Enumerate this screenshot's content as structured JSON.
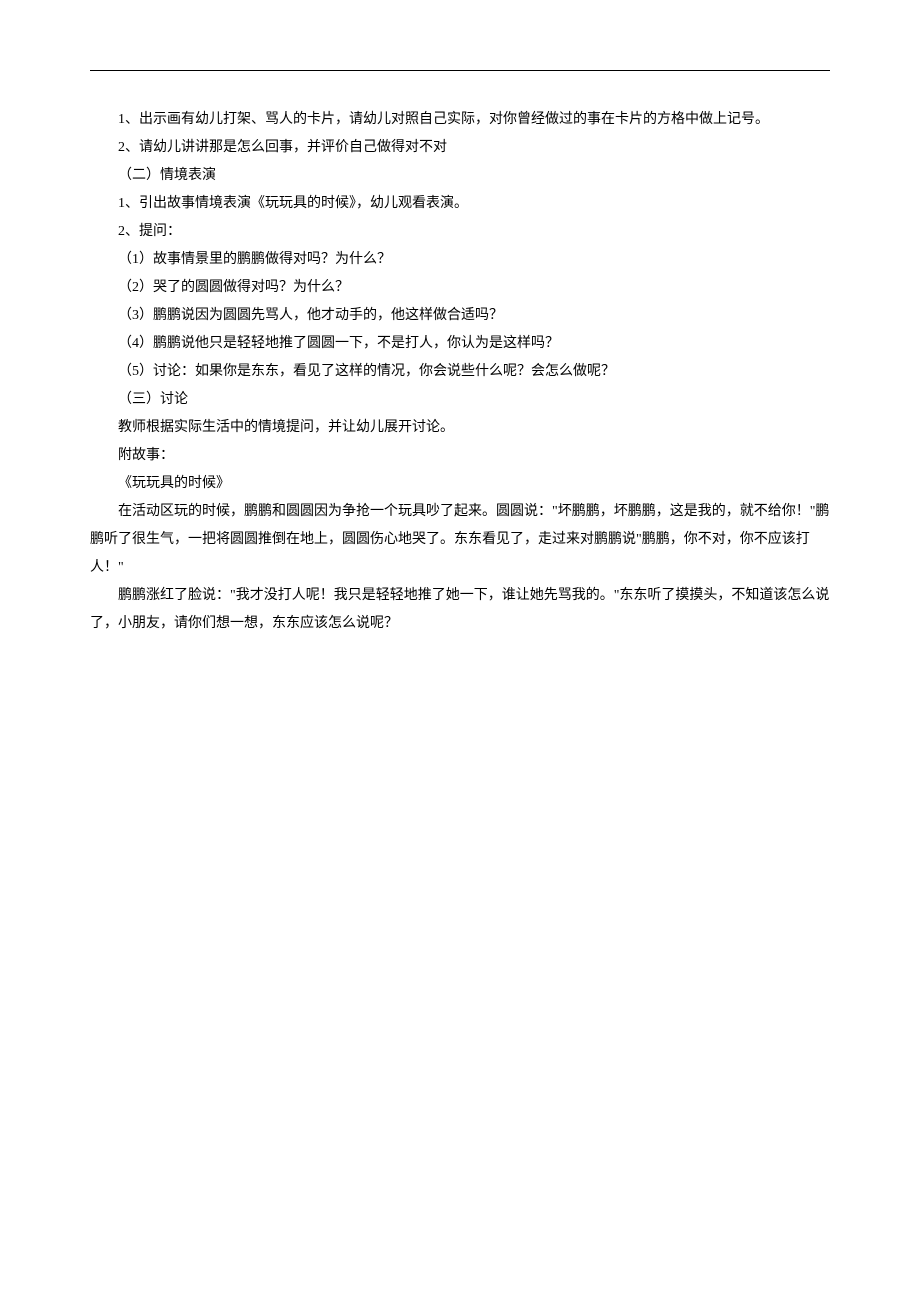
{
  "lines": [
    "1、出示画有幼儿打架、骂人的卡片，请幼儿对照自己实际，对你曾经做过的事在卡片的方格中做上记号。",
    "2、请幼儿讲讲那是怎么回事，并评价自己做得对不对",
    "（二）情境表演",
    "1、引出故事情境表演《玩玩具的时候》，幼儿观看表演。",
    "2、提问：",
    "（1）故事情景里的鹏鹏做得对吗？为什么？",
    "（2）哭了的圆圆做得对吗？为什么？",
    "（3）鹏鹏说因为圆圆先骂人，他才动手的，他这样做合适吗？",
    "（4）鹏鹏说他只是轻轻地推了圆圆一下，不是打人，你认为是这样吗？",
    "（5）讨论：如果你是东东，看见了这样的情况，你会说些什么呢？会怎么做呢？",
    "（三）讨论",
    "教师根据实际生活中的情境提问，并让幼儿展开讨论。",
    "附故事：",
    "《玩玩具的时候》"
  ],
  "paragraphs": [
    "在活动区玩的时候，鹏鹏和圆圆因为争抢一个玩具吵了起来。圆圆说：\"坏鹏鹏，坏鹏鹏，这是我的，就不给你！\"鹏鹏听了很生气，一把将圆圆推倒在地上，圆圆伤心地哭了。东东看见了，走过来对鹏鹏说\"鹏鹏，你不对，你不应该打人！\"",
    "鹏鹏涨红了脸说：\"我才没打人呢！我只是轻轻地推了她一下，谁让她先骂我的。\"东东听了摸摸头，不知道该怎么说了，小朋友，请你们想一想，东东应该怎么说呢？"
  ]
}
